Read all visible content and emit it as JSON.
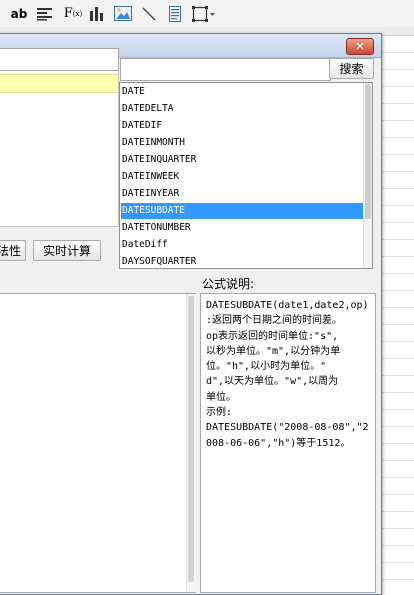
{
  "toolbar": {
    "items": [
      {
        "name": "text-bold-ab",
        "label": "ab"
      },
      {
        "name": "align-left-icon"
      },
      {
        "name": "formula-icon",
        "label": "F",
        "sub": "(x)"
      },
      {
        "name": "bar-chart-icon"
      },
      {
        "name": "image-icon"
      },
      {
        "name": "line-icon"
      },
      {
        "name": "textbox-icon"
      },
      {
        "name": "border-icon"
      }
    ]
  },
  "dialog": {
    "close_label": "✕",
    "search": {
      "value": "",
      "button_label": "搜索"
    },
    "functions": [
      "DATE",
      "DATEDELTA",
      "DATEDIF",
      "DATEINMONTH",
      "DATEINQUARTER",
      "DATEINWEEK",
      "DATEINYEAR",
      "DATESUBDATE",
      "DATETONUMBER",
      "DateDiff",
      "DAYSOFQUARTER"
    ],
    "selected_function": "DATESUBDATE",
    "buttons": {
      "partial_label": "法性",
      "realtime_calc_label": "实时计算"
    },
    "description": {
      "label": "公式说明:",
      "lines": [
        "DATESUBDATE(date1,date2,op)",
        ":返回两个日期之间的时间差。",
        "op表示返回的时间单位:\"s\",",
        "以秒为单位。\"m\",以分钟为单",
        "位。\"h\",以小时为单位。\"",
        "d\",以天为单位。\"w\",以周为",
        "单位。",
        "示例:",
        "DATESUBDATE(\"2008-08-08\",\"2",
        "008-06-06\",\"h\")等于1512。"
      ]
    }
  },
  "colors": {
    "selection": "#3399ff",
    "highlight_row": "#ffffb4",
    "close_button": "#c74a2e"
  }
}
